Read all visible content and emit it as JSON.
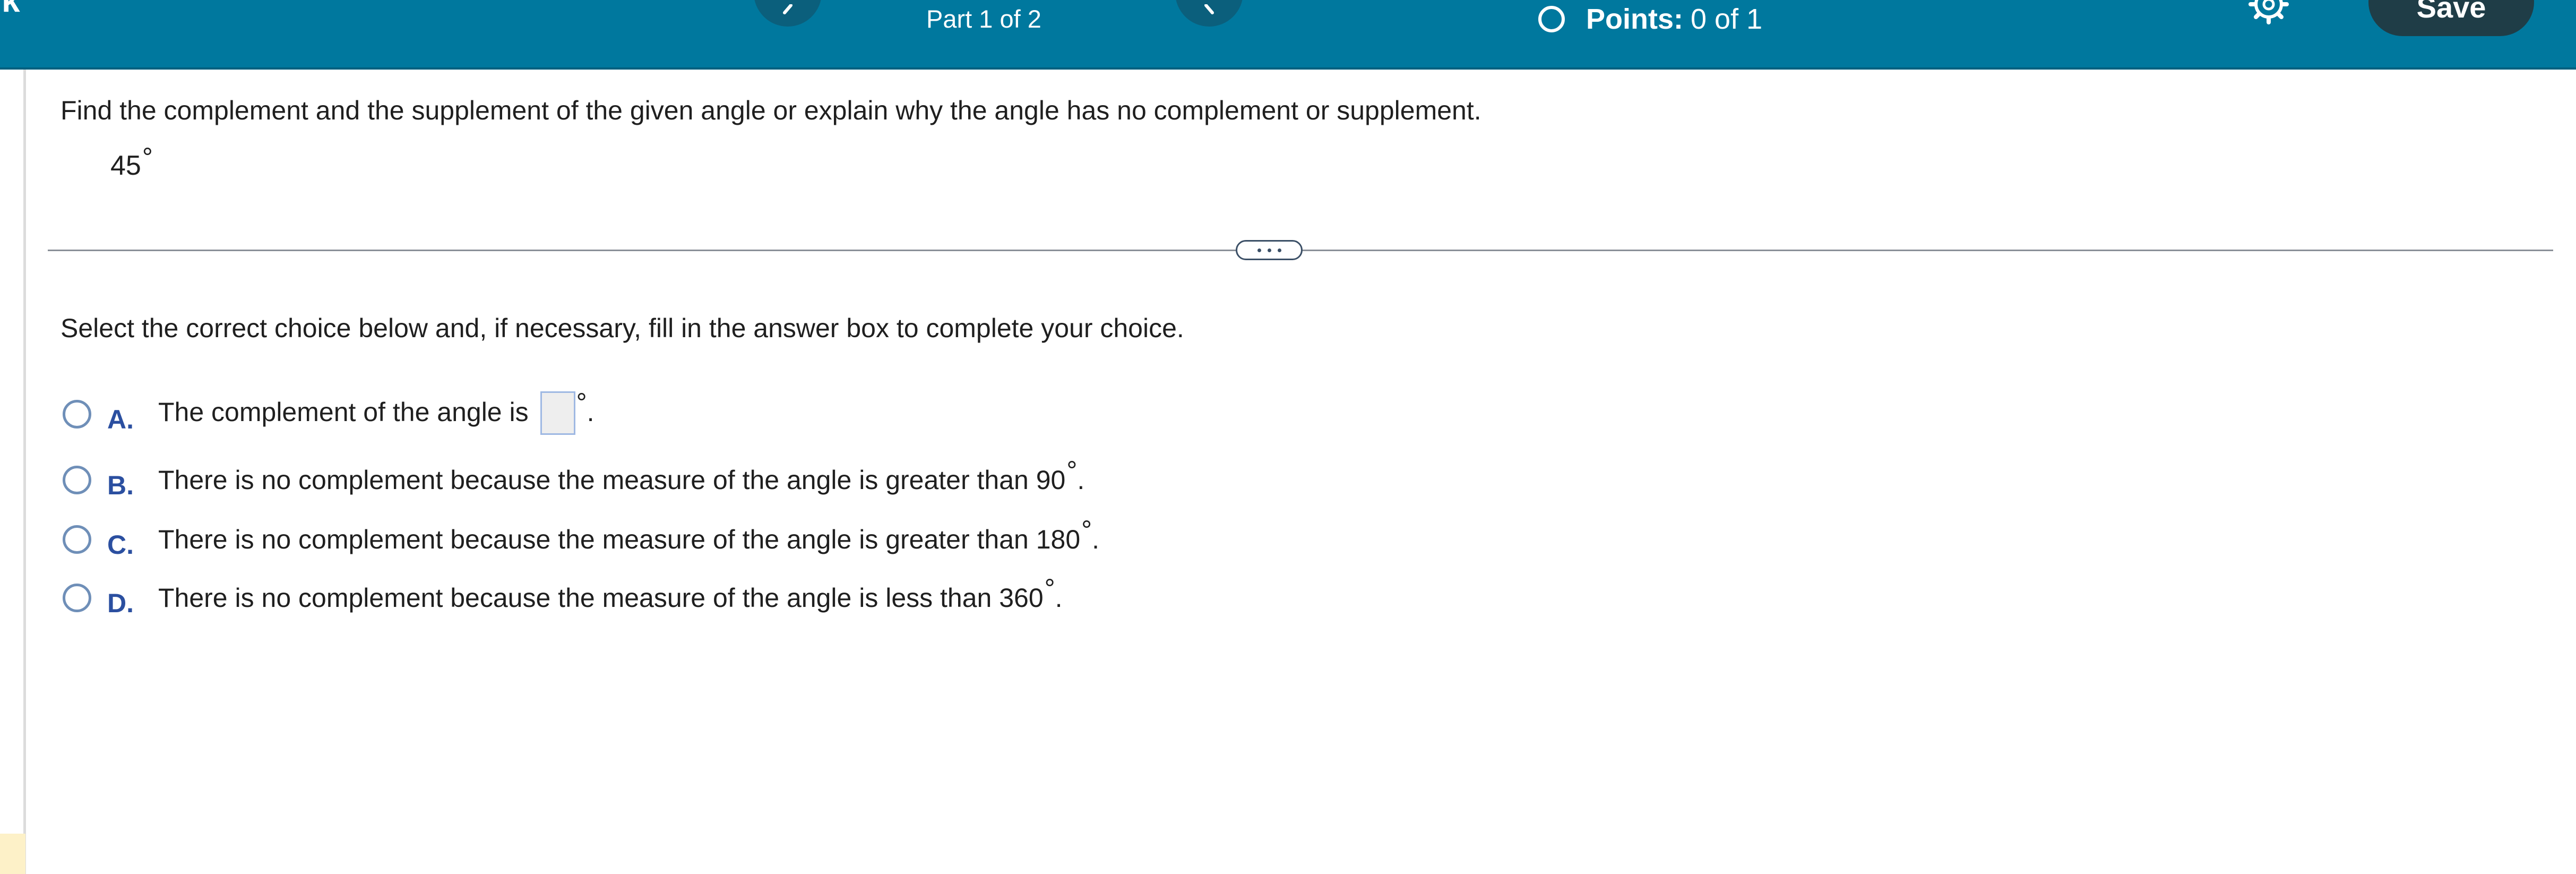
{
  "header": {
    "brand": "rk",
    "part_label": "Part 1 of 2",
    "points_label": "Points:",
    "points_value": "0 of 1",
    "save_label": "Save"
  },
  "question": {
    "prompt": "Find the complement and the supplement of the given angle or explain why the angle has no complement or supplement.",
    "angle_value": "45",
    "angle_unit": "°"
  },
  "instruction": "Select the correct choice below and, if necessary, fill in the answer box to complete your choice.",
  "choices": [
    {
      "letter": "A.",
      "text": "The complement of the angle is",
      "answer": "",
      "suffix": ".",
      "degree": "°"
    },
    {
      "letter": "B.",
      "text": "There is no complement because the measure of the angle is greater than 90",
      "suffix": ".",
      "degree": "°"
    },
    {
      "letter": "C.",
      "text": "There is no complement because the measure of the angle is greater than 180",
      "suffix": ".",
      "degree": "°"
    },
    {
      "letter": "D.",
      "text": "There is no complement because the measure of the angle is less than 360",
      "suffix": ".",
      "degree": "°"
    }
  ],
  "colors": {
    "header_bg": "#00789e",
    "save_button_bg": "#1f3d47",
    "choice_letter": "#2b4fa0",
    "radio_border": "#6f8fb8"
  },
  "icons": {
    "prev": "chevron-left-icon",
    "next": "chevron-right-icon",
    "settings": "gear-icon",
    "points": "circle-status-icon"
  }
}
